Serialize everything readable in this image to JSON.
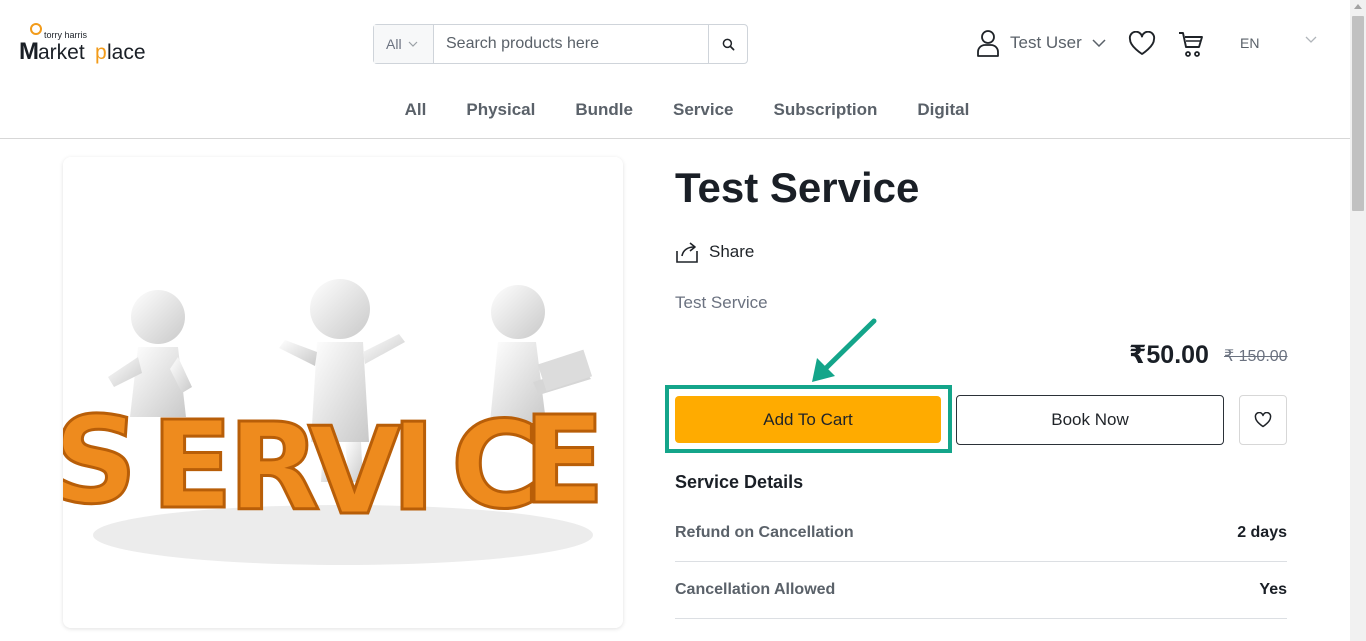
{
  "brand": {
    "small": "torry harris",
    "main": "Marketplace",
    "accent_color": "#f29b1a"
  },
  "search": {
    "category": "All",
    "placeholder": "Search products here"
  },
  "header": {
    "user_name": "Test User",
    "language": "EN"
  },
  "nav": {
    "items": [
      "All",
      "Physical",
      "Bundle",
      "Service",
      "Subscription",
      "Digital"
    ]
  },
  "product": {
    "title": "Test Service",
    "share_label": "Share",
    "description": "Test Service",
    "price": "₹50.00",
    "original_price": "₹ 150.00",
    "image_word": "SERVICE"
  },
  "actions": {
    "add_to_cart": "Add To Cart",
    "book_now": "Book Now"
  },
  "service_details": {
    "title": "Service Details",
    "rows": [
      {
        "label": "Refund on Cancellation",
        "value": "2 days"
      },
      {
        "label": "Cancellation Allowed",
        "value": "Yes"
      }
    ]
  },
  "colors": {
    "cart_button": "#ffab00",
    "highlight": "#14a58a",
    "text_dark": "#1a1f26",
    "text_muted": "#5a6169"
  }
}
